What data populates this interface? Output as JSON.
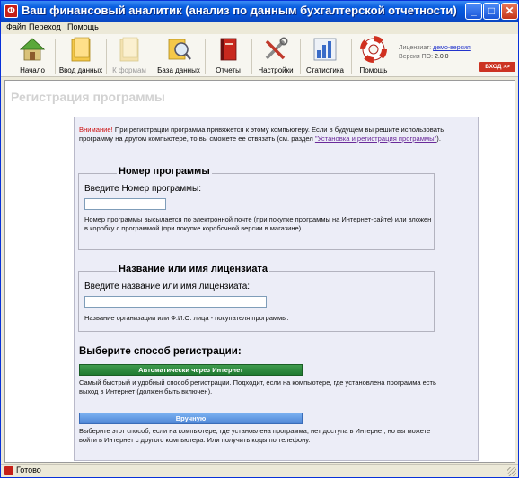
{
  "window": {
    "title": "Ваш финансовый аналитик (анализ по данным бухгалтерской отчетности)",
    "icon_letter": "Ф",
    "minimize": "_",
    "maximize": "□",
    "close": "✕"
  },
  "menu": [
    "Файл",
    "Переход",
    "Помощь"
  ],
  "toolbar": [
    {
      "label": "Начало",
      "icon": "home-icon",
      "enabled": true
    },
    {
      "label": "Ввод данных",
      "icon": "folder-icon",
      "enabled": true
    },
    {
      "label": "К формам",
      "icon": "folder-forms-icon",
      "enabled": false
    },
    {
      "label": "База данных",
      "icon": "database-search-icon",
      "enabled": true
    },
    {
      "label": "Отчеты",
      "icon": "book-icon",
      "enabled": true
    },
    {
      "label": "Настройки",
      "icon": "tools-icon",
      "enabled": true
    },
    {
      "label": "Статистика",
      "icon": "bar-chart-icon",
      "enabled": true
    },
    {
      "label": "Помощь",
      "icon": "lifebuoy-icon",
      "enabled": true
    }
  ],
  "license": {
    "licensee_label": "Лицензиат:",
    "licensee_value": "демо-версия",
    "version_label": "Версия ПО:",
    "version_value": "2.0.0",
    "login_button": "ВХОД >>"
  },
  "page": {
    "title": "Регистрация программы",
    "notice_warn": "Внимание!",
    "notice_text": " При регистрации программа привяжется к этому компьютеру. Если в будущем вы решите использовать программу на другом компьютере, то вы сможете ее отвязать (см. раздел ",
    "notice_link": "\"Установка и регистрация программы\"",
    "notice_end": ").",
    "number_section": {
      "legend": "Номер программы",
      "label": "Введите Номер программы:",
      "value": "",
      "help": "Номер программы высылается по электронной почте (при покупке программы на Интернет-сайте) или вложен в коробку с программой (при покупке коробочной версии в магазине)."
    },
    "name_section": {
      "legend": "Название или имя лицензиата",
      "label": "Введите название или имя лицензиата:",
      "value": "",
      "help": "Название организации или Ф.И.О. лица - покупателя программы."
    },
    "registration": {
      "title": "Выберите способ регистрации:",
      "auto_button": "Автоматически через Интернет",
      "auto_desc": "Самый быстрый и удобный способ регистрации. Подходит, если на компьютере, где установлена программа есть выход в Интернет (должен быть включен).",
      "manual_button": "Вручную",
      "manual_desc": "Выберите этот способ, если на компьютере, где установлена программа, нет доступа в Интернет, но вы можете войти в Интернет с другого компьютера. Или получить коды по телефону."
    }
  },
  "status": {
    "text": "Готово"
  }
}
